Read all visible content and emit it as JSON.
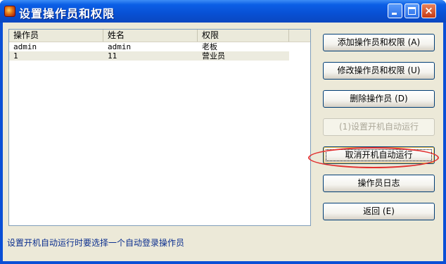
{
  "window": {
    "title": "设置操作员和权限",
    "icon": "app-icon",
    "controls": {
      "minimize": "minimize-icon",
      "maximize": "maximize-icon",
      "close": "×"
    }
  },
  "list": {
    "columns": [
      "操作员",
      "姓名",
      "权限"
    ],
    "rows": [
      [
        "admin",
        "admin",
        "老板"
      ],
      [
        "1",
        "11",
        "营业员"
      ]
    ]
  },
  "buttons": {
    "add": "添加操作员和权限 (A)",
    "modify": "修改操作员和权限 (U)",
    "delete": "删除操作员 (D)",
    "set_autorun": "(1)设置开机自动运行",
    "cancel_autorun": "取消开机自动运行",
    "log": "操作员日志",
    "back": "返回 (E)"
  },
  "status_text": "设置开机自动运行时要选择一个自动登录操作员",
  "colors": {
    "titlebar": "#0a4fd6",
    "highlight_ellipse": "#e23030",
    "status_text": "#0b2f8f"
  }
}
